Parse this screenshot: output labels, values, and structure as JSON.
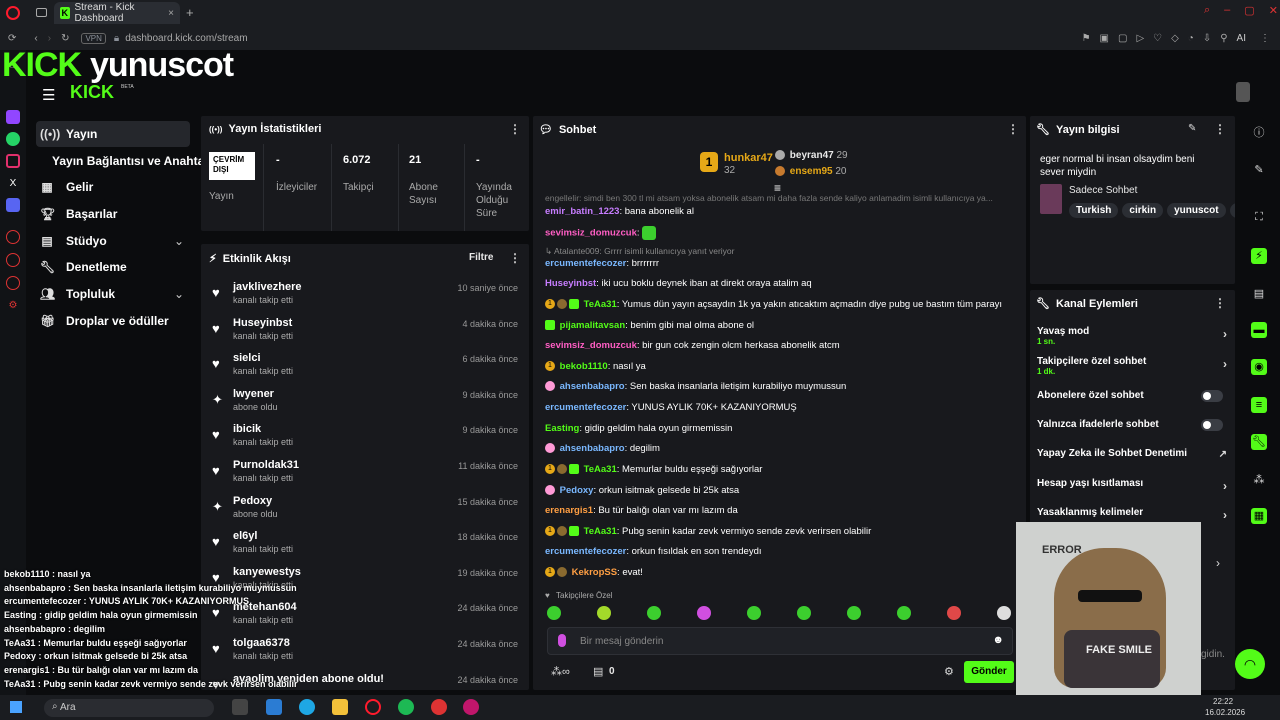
{
  "browser": {
    "tab_title": "Stream - Kick Dashboard",
    "url": "dashboard.kick.com/stream",
    "vpn": "VPN",
    "ai": "AI"
  },
  "header": {
    "logo_kick": "KICK",
    "channel": "yunuscot",
    "logo_small": "KICK",
    "beta": "BETA"
  },
  "nav": {
    "items": [
      "Yayın",
      "Yayın Bağlantısı ve Anahtarı",
      "Gelir",
      "Başarılar",
      "Stüdyo",
      "Denetleme",
      "Topluluk",
      "Droplar ve ödüller"
    ]
  },
  "stats": {
    "title": "Yayın İstatistikleri",
    "status": "ÇEVRİM DIŞI",
    "status_label": "Yayın",
    "viewers_value": "-",
    "viewers_label": "İzleyiciler",
    "followers_value": "6.072",
    "followers_label": "Takipçi",
    "subs_value": "21",
    "subs_label": "Abone Sayısı",
    "time_value": "-",
    "time_label": "Yayında Olduğu Süre"
  },
  "activity": {
    "title": "Etkinlik Akışı",
    "filter": "Filtre",
    "items": [
      {
        "name": "javklivezhere",
        "sub": "kanalı takip etti",
        "time": "10 saniye önce"
      },
      {
        "name": "Huseyinbst",
        "sub": "kanalı takip etti",
        "time": "4 dakika önce"
      },
      {
        "name": "sielci",
        "sub": "kanalı takip etti",
        "time": "6 dakika önce"
      },
      {
        "name": "lwyener",
        "sub": "abone oldu",
        "time": "9 dakika önce"
      },
      {
        "name": "ibicik",
        "sub": "kanalı takip etti",
        "time": "9 dakika önce"
      },
      {
        "name": "Purnoldak31",
        "sub": "kanalı takip etti",
        "time": "11 dakika önce"
      },
      {
        "name": "Pedoxy",
        "sub": "abone oldu",
        "time": "15 dakika önce"
      },
      {
        "name": "el6yl",
        "sub": "kanalı takip etti",
        "time": "18 dakika önce"
      },
      {
        "name": "kanyewestys",
        "sub": "kanalı takip etti",
        "time": "19 dakika önce"
      },
      {
        "name": "metehan604",
        "sub": "kanalı takip etti",
        "time": "24 dakika önce"
      },
      {
        "name": "tolgaa6378",
        "sub": "kanalı takip etti",
        "time": "24 dakika önce"
      },
      {
        "name": "ayaolim yeniden abone oldu!",
        "sub": "",
        "time": "24 dakika önce"
      }
    ]
  },
  "chat": {
    "title": "Sohbet",
    "top": [
      {
        "name": "hunkar47",
        "count": "32"
      },
      {
        "name": "beyran47",
        "count": "29"
      },
      {
        "name": "ensem95",
        "count": "20"
      }
    ],
    "faded": "engellelir: simdi ben 300 tl mi atsam yoksa abonelik atsam mi daha fazla sende kaliyo anlamadim isimli kullanıcıya ya...",
    "messages": [
      {
        "user": "emir_batin_1223",
        "color": "#c77dff",
        "text": "bana abonelik al"
      },
      {
        "user": "sevimsiz_domuzcuk",
        "color": "#ff5ec4",
        "text": ""
      },
      {
        "reply": "Atalante009: Grrrr isimli kullanıcıya yanıt veriyor"
      },
      {
        "user": "ercumentefecozer",
        "color": "#7ab8ff",
        "text": "brrrrrrr"
      },
      {
        "user": "Huseyinbst",
        "color": "#c77dff",
        "text": "iki ucu boklu deynek iban at direkt oraya atalim aq"
      },
      {
        "user": "TeAa31",
        "color": "#53fc18",
        "text": "Yumus dün yayın açsaydın 1k ya yakın atıcaktım açmadın diye pubg ue bastım tüm parayı"
      },
      {
        "user": "pijamalitavsan",
        "color": "#53fc18",
        "text": "benim gibi mal olma abone ol"
      },
      {
        "user": "sevimsiz_domuzcuk",
        "color": "#ff5ec4",
        "text": "bir gun cok zengin olcm herkasa abonelik atcm"
      },
      {
        "user": "bekob1110",
        "color": "#53fc18",
        "text": "nasıl ya"
      },
      {
        "user": "ahsenbabapro",
        "color": "#7ab8ff",
        "text": "Sen baska insanlarla iletişim kurabiliyo muymussun"
      },
      {
        "user": "ercumentefecozer",
        "color": "#7ab8ff",
        "text": "YUNUS AYLIK 70K+ KAZANIYORMUŞ"
      },
      {
        "user": "Easting",
        "color": "#53fc18",
        "text": "gidip geldim hala oyun girmemissin"
      },
      {
        "user": "ahsenbabapro",
        "color": "#7ab8ff",
        "text": "degilim"
      },
      {
        "user": "TeAa31",
        "color": "#53fc18",
        "text": "Memurlar buldu eşşeği sağıyorlar"
      },
      {
        "user": "Pedoxy",
        "color": "#7ab8ff",
        "text": "orkun isitmak gelsede bi 25k atsa"
      },
      {
        "user": "erenargis1",
        "color": "#ff9f43",
        "text": "Bu tür balığı olan var mı lazım da"
      },
      {
        "user": "TeAa31",
        "color": "#53fc18",
        "text": "Pubg senin kadar zevk vermiyo sende zevk verirsen olabilir"
      },
      {
        "user": "ercumentefecozer",
        "color": "#7ab8ff",
        "text": "orkun fısıldak en son trendeydı"
      },
      {
        "user": "KekropSS",
        "color": "#ff9f43",
        "text": "evat!"
      }
    ],
    "followers_only": "Takipçilere Özel",
    "placeholder": "Bir mesaj gönderin",
    "points": "0",
    "send": "Gönder"
  },
  "streaminfo": {
    "title": "Yayın bilgisi",
    "stream_title": "eger normal bi insan olsaydim beni sever miydin",
    "category": "Sadece Sohbet",
    "tags": [
      "Turkish",
      "cirkin",
      "yunuscot",
      "c"
    ]
  },
  "channel_actions": {
    "title": "Kanal Eylemleri",
    "items": [
      {
        "label": "Yavaş mod",
        "sub": "1 sn."
      },
      {
        "label": "Takipçilere özel sohbet",
        "sub": "1 dk."
      },
      {
        "label": "Abonelere özel sohbet",
        "sub": ""
      },
      {
        "label": "Yalnızca ifadelerle sohbet",
        "sub": ""
      },
      {
        "label": "Yapay Zeka ile Sohbet Denetimi",
        "sub": ""
      },
      {
        "label": "Hesap yaşı kısıtlaması",
        "sub": ""
      },
      {
        "label": "Yasaklanmış kelimeler",
        "sub": ""
      }
    ]
  },
  "overlay": {
    "error": "ERROR",
    "fake_smile": "FAKE SMILE",
    "partial": "gidin.",
    "lines": [
      "bekob1110 : nasıl ya",
      "ahsenbabapro : Sen baska insanlarla iletişim kurabiliyo muymussun",
      "ercumentefecozer : YUNUS AYLIK 70K+ KAZANIYORMUŞ",
      "Easting : gidip geldim hala oyun girmemissin",
      "ahsenbabapro : degilim",
      "TeAa31 : Memurlar buldu eşşeği sağıyorlar",
      "Pedoxy : orkun isitmak gelsede bi 25k atsa",
      "erenargis1 : Bu tür balığı olan var mı lazım da",
      "TeAa31 : Pubg senin kadar zevk vermiyo sende zevk verirsen olabilir"
    ]
  },
  "taskbar": {
    "search": "Ara",
    "time": "22:22",
    "date": "16.02.2026"
  }
}
